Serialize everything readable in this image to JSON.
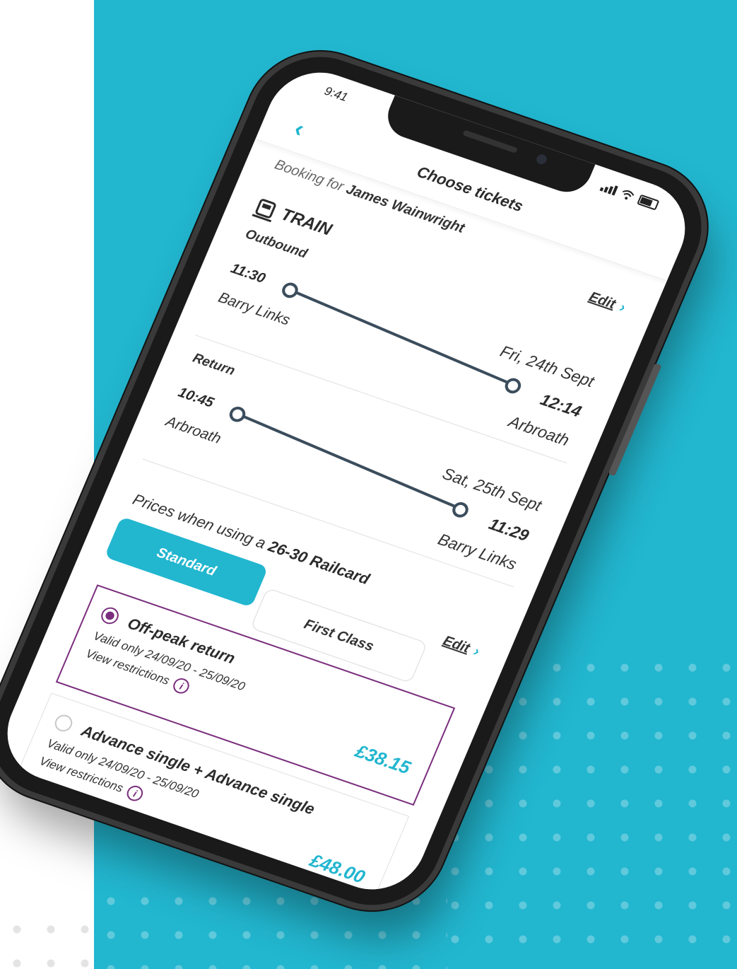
{
  "status_bar": {
    "time": "9:41"
  },
  "nav": {
    "title": "Choose tickets"
  },
  "booking": {
    "prefix": "Booking for",
    "name": "James Wainwright",
    "edit_label": "Edit"
  },
  "mode": {
    "label": "TRAIN"
  },
  "legs": [
    {
      "label": "Outbound",
      "date": "Fri, 24th Sept",
      "dep_time": "11:30",
      "dep_station": "Barry Links",
      "arr_time": "12:14",
      "arr_station": "Arbroath"
    },
    {
      "label": "Return",
      "date": "Sat, 25th Sept",
      "dep_time": "10:45",
      "dep_station": "Arbroath",
      "arr_time": "11:29",
      "arr_station": "Barry Links"
    }
  ],
  "prices": {
    "prefix": "Prices when using a",
    "railcard": "26-30 Railcard",
    "edit_label": "Edit"
  },
  "classes": {
    "standard": "Standard",
    "first": "First Class",
    "selected": "Standard"
  },
  "tickets": [
    {
      "name": "Off-peak return",
      "valid": "Valid only 24/09/20 - 25/09/20",
      "restrictions": "View restrictions",
      "price": "£38.15",
      "selected": true
    },
    {
      "name": "Advance single + Advance single",
      "valid": "Valid only 24/09/20 - 25/09/20",
      "restrictions": "View restrictions",
      "price": "£48.00",
      "selected": false
    }
  ],
  "colors": {
    "accent": "#22b6cf",
    "selected": "#7a2e7d",
    "route": "#3b4d5c"
  }
}
